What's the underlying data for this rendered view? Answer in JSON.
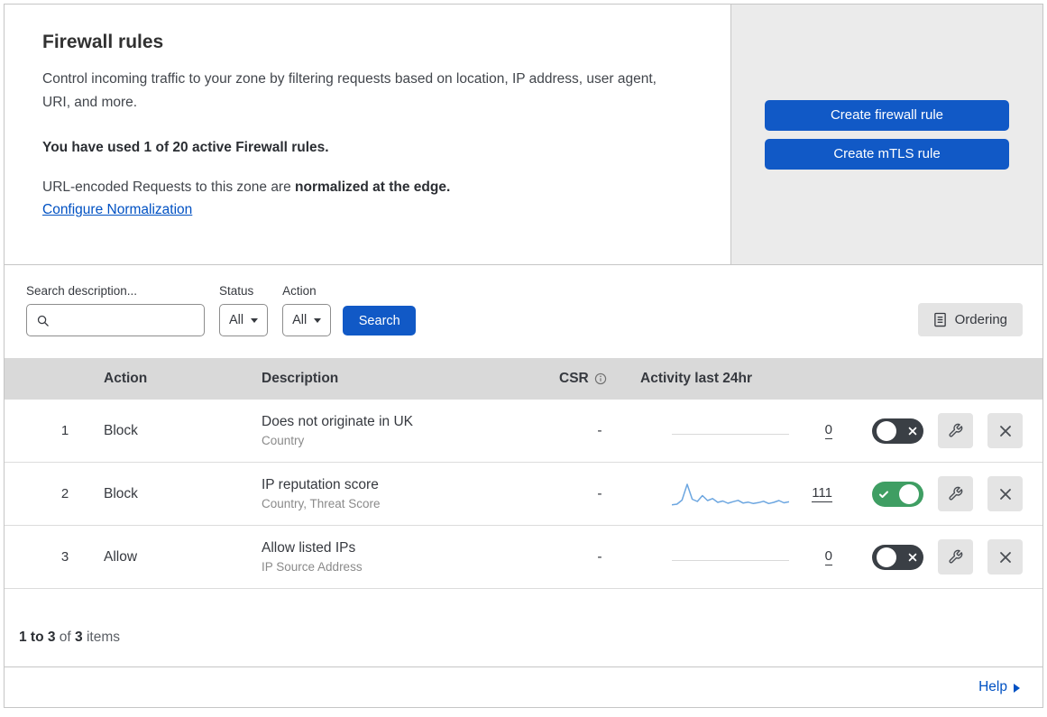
{
  "colors": {
    "accent": "#1159c6",
    "link": "#0051c3",
    "toggle_on": "#3f9e63",
    "toggle_off": "#3a3f45",
    "sparkline": "#6ca6e0"
  },
  "header": {
    "title": "Firewall rules",
    "description": "Control incoming traffic to your zone by filtering requests based on location, IP address, user agent, URI, and more.",
    "usage": "You have used 1 of 20 active Firewall rules.",
    "normalization_prefix": "URL-encoded Requests to this zone are ",
    "normalization_bold": "normalized at the edge.",
    "normalization_link": "Configure Normalization",
    "create_firewall_button": "Create firewall rule",
    "create_mtls_button": "Create mTLS rule"
  },
  "filters": {
    "search_label": "Search description...",
    "status_label": "Status",
    "status_value": "All",
    "action_label": "Action",
    "action_value": "All",
    "search_button": "Search",
    "ordering_button": "Ordering"
  },
  "table": {
    "headers": {
      "action": "Action",
      "description": "Description",
      "csr": "CSR",
      "activity": "Activity last 24hr"
    },
    "rows": [
      {
        "num": "1",
        "action": "Block",
        "description": "Does not originate in UK",
        "criteria": "Country",
        "csr": "-",
        "count": "0",
        "enabled": false
      },
      {
        "num": "2",
        "action": "Block",
        "description": "IP reputation score",
        "criteria": "Country, Threat Score",
        "csr": "-",
        "count": "111",
        "enabled": true
      },
      {
        "num": "3",
        "action": "Allow",
        "description": "Allow listed IPs",
        "criteria": "IP Source Address",
        "csr": "-",
        "count": "0",
        "enabled": false
      }
    ]
  },
  "chart_data": {
    "type": "line",
    "title": "Activity last 24hr sparkline (rule 2)",
    "values": [
      5,
      8,
      26,
      96,
      30,
      20,
      46,
      24,
      33,
      16,
      22,
      12,
      19,
      25,
      13,
      17,
      11,
      15,
      21,
      11,
      16,
      24,
      14,
      19
    ],
    "total_label": "111"
  },
  "footer": {
    "range": "1 to 3",
    "of_text": " of ",
    "total": "3",
    "items_text": " items",
    "help": "Help"
  }
}
